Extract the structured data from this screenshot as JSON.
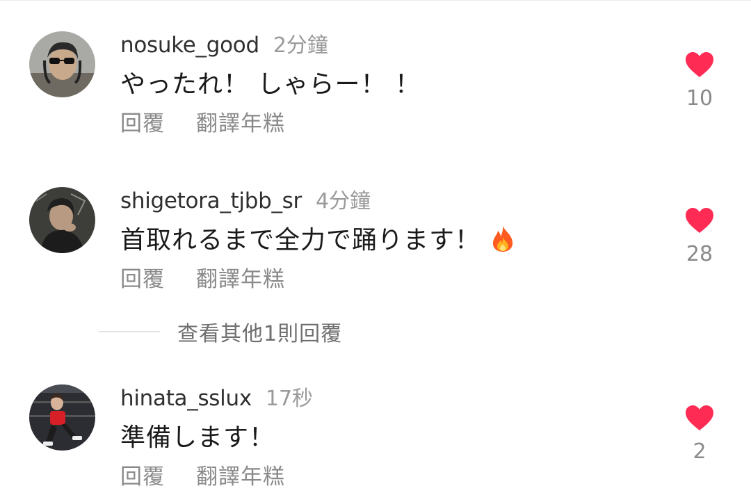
{
  "comments": [
    {
      "username": "nosuke_good",
      "time": "2分鐘",
      "text": "やったれ！ しゃらー！ ！",
      "reply_label": "回覆",
      "translate_label": "翻譯年糕",
      "likes": "10",
      "like_icon": "heart-icon",
      "like_color": "#fe2c55"
    },
    {
      "username": "shigetora_tjbb_sr",
      "time": "4分鐘",
      "text": "首取れるまで全力で踊ります！",
      "text_emoji": "fire-emoji",
      "reply_label": "回覆",
      "translate_label": "翻譯年糕",
      "likes": "28",
      "like_icon": "heart-icon",
      "like_color": "#fe2c55"
    },
    {
      "username": "hinata_sslux",
      "time": "17秒",
      "text": "準備します！",
      "reply_label": "回覆",
      "translate_label": "翻譯年糕",
      "likes": "2",
      "like_icon": "heart-icon",
      "like_color": "#fe2c55"
    }
  ],
  "view_more_replies": "查看其他1則回覆"
}
